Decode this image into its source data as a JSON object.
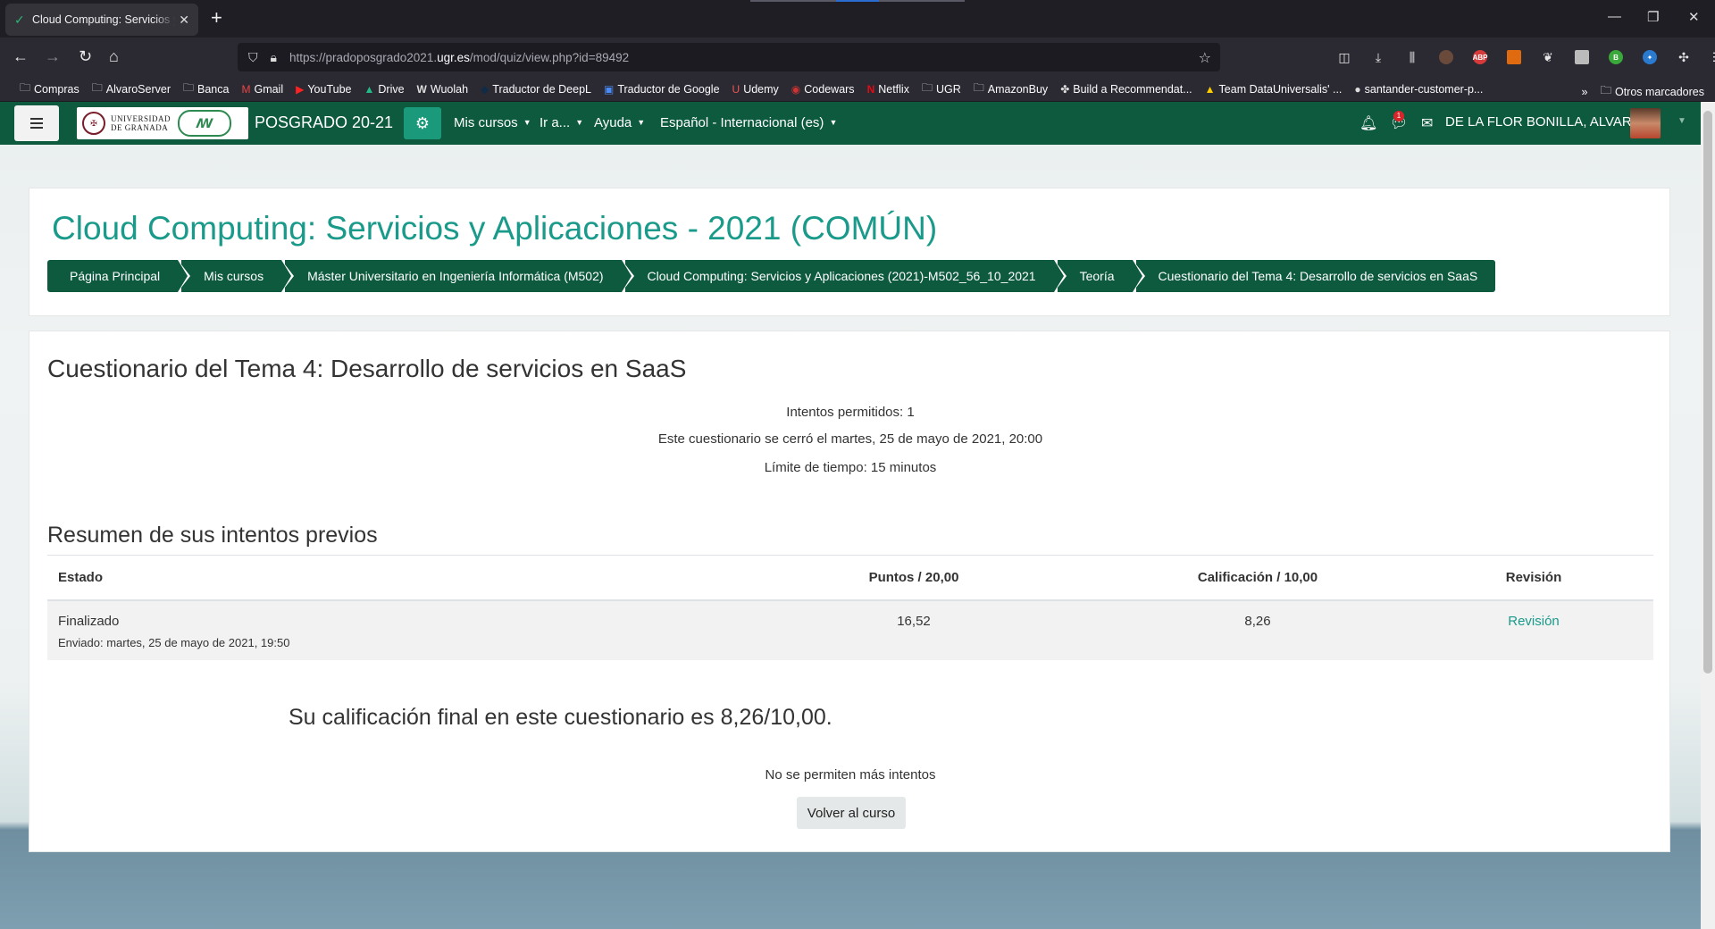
{
  "browser": {
    "tab_title": "Cloud Computing: Servicios y Aplicaciones",
    "url_prefix": "https://pradoposgrado2021.",
    "url_domain": "ugr.es",
    "url_path": "/mod/quiz/view.php?id=89492",
    "bookmarks": [
      "Compras",
      "AlvaroServer",
      "Banca",
      "Gmail",
      "YouTube",
      "Drive",
      "Wuolah",
      "Traductor de DeepL",
      "Traductor de Google",
      "Udemy",
      "Codewars",
      "Netflix",
      "UGR",
      "AmazonBuy",
      "Build a Recommendat...",
      "Team DataUniversalis' ...",
      "santander-customer-p..."
    ],
    "other_bookmarks": "Otros marcadores"
  },
  "site": {
    "logo_line1": "UNIVERSIDAD",
    "logo_line2": "DE GRANADA",
    "name": "POSGRADO 20-21",
    "menu": [
      "Mis cursos",
      "Ir a...",
      "Ayuda",
      "Español - Internacional (es)"
    ],
    "notification_count": "1",
    "user": "DE LA FLOR BONILLA, ALVARO"
  },
  "course": {
    "title": "Cloud Computing: Servicios y Aplicaciones - 2021 (COMÚN)",
    "breadcrumbs": [
      "Página Principal",
      "Mis cursos",
      "Máster Universitario en Ingeniería Informática (M502)",
      "Cloud Computing: Servicios y Aplicaciones (2021)-M502_56_10_2021",
      "Teoría",
      "Cuestionario del Tema 4: Desarrollo de servicios en SaaS"
    ]
  },
  "quiz": {
    "title": "Cuestionario del Tema 4: Desarrollo de servicios en SaaS",
    "attempts_allowed": "Intentos permitidos: 1",
    "closed": "Este cuestionario se cerró el martes, 25 de mayo de 2021, 20:00",
    "time_limit": "Límite de tiempo: 15 minutos",
    "summary_title": "Resumen de sus intentos previos",
    "table": {
      "headers": [
        "Estado",
        "Puntos / 20,00",
        "Calificación / 10,00",
        "Revisión"
      ],
      "row": {
        "state": "Finalizado",
        "submitted": "Enviado: martes, 25 de mayo de 2021, 19:50",
        "points": "16,52",
        "grade": "8,26",
        "review": "Revisión"
      }
    },
    "final_grade": "Su calificación final en este cuestionario es 8,26/10,00.",
    "no_more": "No se permiten más intentos",
    "back_button": "Volver al curso"
  },
  "colors": {
    "brand_green": "#0d5a3f",
    "accent_teal": "#1a9a8a"
  }
}
